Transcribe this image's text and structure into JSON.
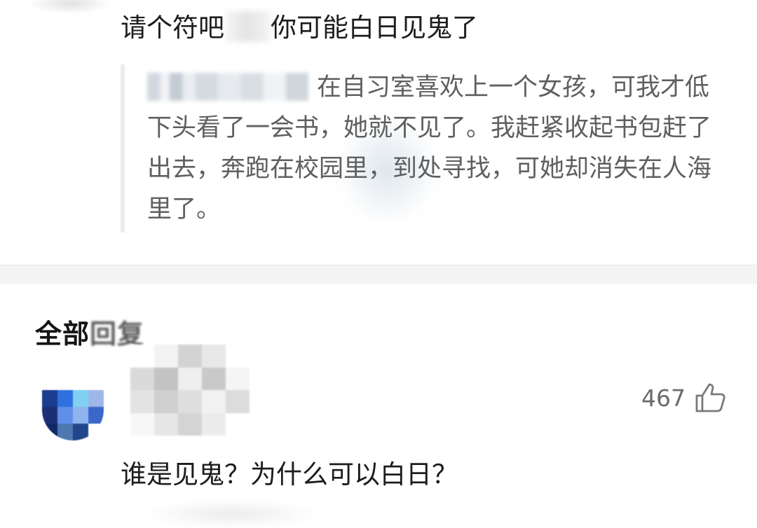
{
  "reply": {
    "part1": "请个符吧",
    "part2": "你可能白日见鬼了"
  },
  "quote": {
    "tail_glyph": "。",
    "text": "在自习室喜欢上一个女孩，可我才低下头看了一会书，她就不见了。我赶紧收起书包赶了出去，奔跑在校园里，到处寻找，可她却消失在人海里了。"
  },
  "section": {
    "title_clear": "全部",
    "title_faded": "回复"
  },
  "comment": {
    "likes": "467",
    "like_icon": "thumbs-up-icon",
    "text": "谁是见鬼？为什么可以白日？"
  },
  "colors": {
    "avatar_blue_dark": "#1a3d8f",
    "avatar_blue_mid": "#2f6fe0",
    "avatar_blue_light": "#7fd0f2",
    "text_primary": "#1c1c1c",
    "text_quote": "#5f5f5f",
    "like_gray": "#6b6b6b"
  }
}
